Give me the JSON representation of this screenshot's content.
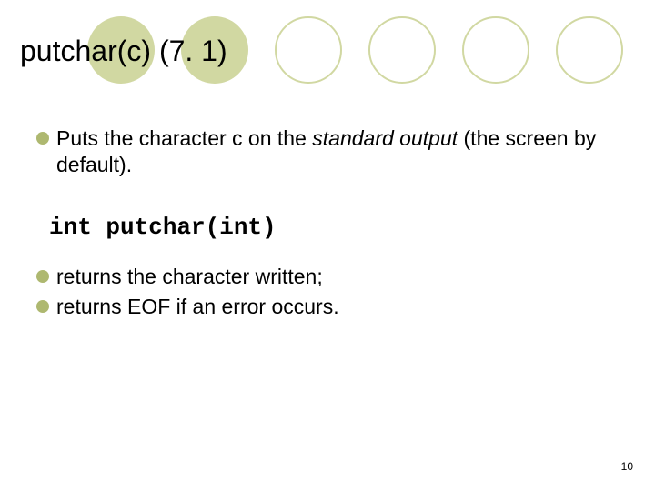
{
  "title": "putchar(c) (7. 1)",
  "bullets": {
    "b1_pre": "Puts the character c on the ",
    "b1_em": "standard output",
    "b1_post": " (the screen by default).",
    "b2": "returns the character written;",
    "b3": "returns EOF if an error occurs."
  },
  "code": "int putchar(int)",
  "page_number": "10"
}
